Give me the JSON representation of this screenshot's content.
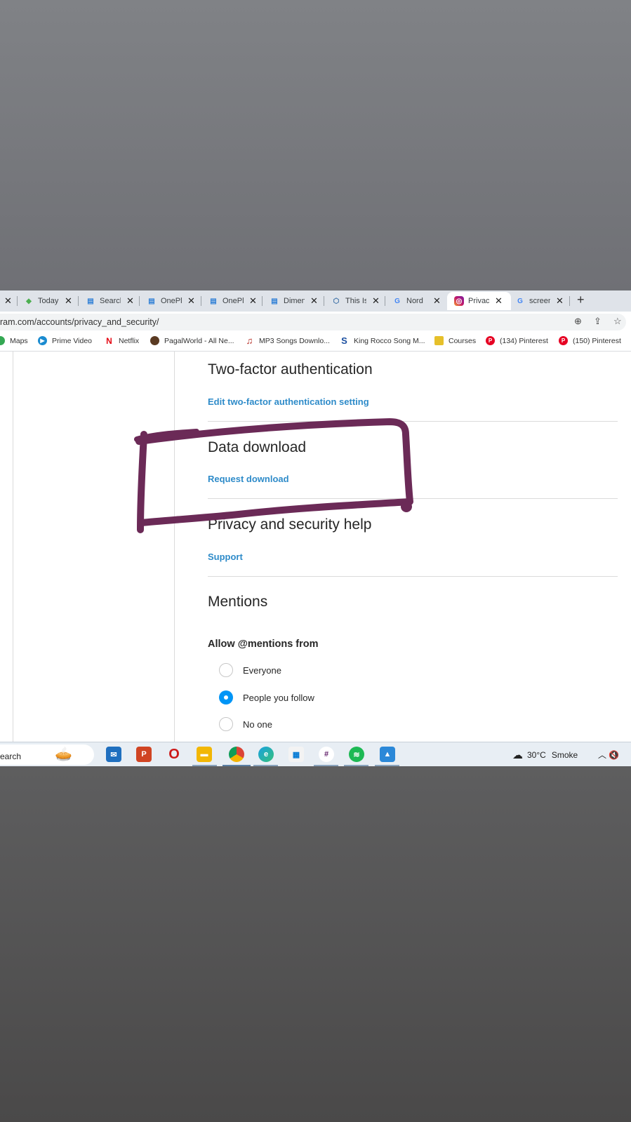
{
  "browser": {
    "tabs": [
      {
        "title": "Today",
        "icon": "todoist-icon"
      },
      {
        "title": "Search",
        "icon": "oneplus-community-icon"
      },
      {
        "title": "OnePlus",
        "icon": "oneplus-community-icon"
      },
      {
        "title": "OnePlus",
        "icon": "oneplus-community-icon"
      },
      {
        "title": "Dimen",
        "icon": "oneplus-community-icon"
      },
      {
        "title": "This Is",
        "icon": "cube-icon"
      },
      {
        "title": "Nord",
        "icon": "google-icon"
      },
      {
        "title": "Privacy",
        "icon": "instagram-icon",
        "active": true
      },
      {
        "title": "screen",
        "icon": "google-icon"
      }
    ],
    "new_tab": "+",
    "url": "ram.com/accounts/privacy_and_security/",
    "bookmarks": [
      {
        "label": "Maps",
        "icon": "maps-icon"
      },
      {
        "label": "Prime Video",
        "icon": "prime-video-icon"
      },
      {
        "label": "Netflix",
        "icon": "netflix-icon"
      },
      {
        "label": "PagalWorld - All Ne...",
        "icon": "avatar-icon"
      },
      {
        "label": "MP3 Songs Downlo...",
        "icon": "music-note-icon"
      },
      {
        "label": "King Rocco Song M...",
        "icon": "s-logo-icon"
      },
      {
        "label": "Courses",
        "icon": "courses-icon"
      },
      {
        "label": "(134) Pinterest",
        "icon": "pinterest-icon"
      },
      {
        "label": "(150) Pinterest",
        "icon": "pinterest-icon"
      }
    ]
  },
  "settings": {
    "two_factor": {
      "title": "Two-factor authentication",
      "link": "Edit two-factor authentication setting"
    },
    "data_download": {
      "title": "Data download",
      "link": "Request download"
    },
    "help": {
      "title": "Privacy and security help",
      "link": "Support"
    },
    "mentions": {
      "title": "Mentions",
      "subtitle": "Allow @mentions from",
      "options": [
        {
          "label": "Everyone",
          "selected": false
        },
        {
          "label": "People you follow",
          "selected": true
        },
        {
          "label": "No one",
          "selected": false
        }
      ]
    }
  },
  "annotation": {
    "color": "#6b2a57"
  },
  "taskbar": {
    "search_label": "earch",
    "weather_temp": "30°C",
    "weather_desc": "Smoke",
    "pinned_icons": [
      "mail-icon",
      "office-icon",
      "opera-icon",
      "file-explorer-icon",
      "chrome-icon",
      "edge-icon",
      "store-icon",
      "slack-icon",
      "spotify-icon",
      "photos-icon"
    ]
  }
}
